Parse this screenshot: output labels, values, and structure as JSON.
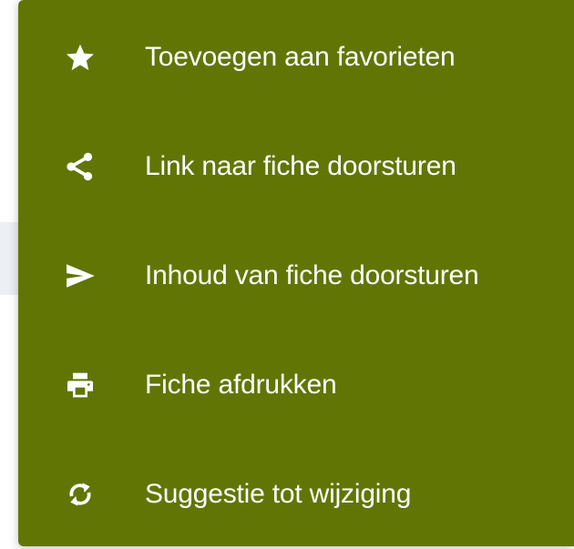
{
  "menu": {
    "background_color": "#617505",
    "text_color": "#ffffff",
    "items": [
      {
        "label": "Toevoegen aan favorieten",
        "icon": "star-icon"
      },
      {
        "label": "Link naar fiche doorsturen",
        "icon": "share-icon"
      },
      {
        "label": "Inhoud van fiche doorsturen",
        "icon": "send-icon"
      },
      {
        "label": "Fiche afdrukken",
        "icon": "print-icon"
      },
      {
        "label": "Suggestie tot wijziging",
        "icon": "refresh-icon"
      }
    ]
  }
}
